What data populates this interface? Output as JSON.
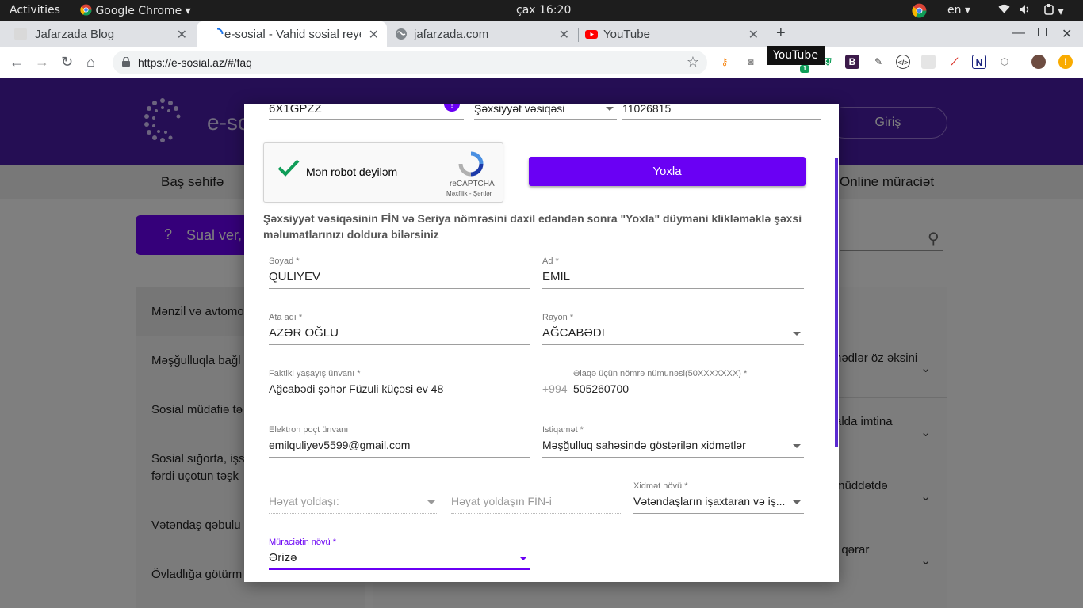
{
  "topbar": {
    "activities": "Activities",
    "app_name": "Google Chrome",
    "clock": "çax 16:20",
    "language": "en"
  },
  "tabs": [
    {
      "label": "Jafarzada Blog",
      "icon": "blog-icon"
    },
    {
      "label": "e-sosial - Vahid sosial reye",
      "icon": "loading-icon"
    },
    {
      "label": "jafarzada.com",
      "icon": "globe-icon"
    },
    {
      "label": "YouTube",
      "icon": "youtube-icon"
    }
  ],
  "toolbar": {
    "url": "https://e-sosial.az/#/faq"
  },
  "tooltip": "YouTube",
  "background": {
    "logo_text": "e-so",
    "login_label": "Giriş",
    "nav_home": "Baş səhifə",
    "nav_online": "Online müraciət",
    "ask_button": "Sual ver,",
    "sidebar_items": [
      "Mənzil və avtomo",
      "Məşğulluqla bağl",
      "Sosial müdafiə tə",
      "Sosial sığorta, işs",
      "fərdi uçotun təşk",
      "Vətəndaş qəbulu",
      "Övladlığa götürm"
    ],
    "right_texts": [
      "hədlər öz əksini",
      "alda imtina",
      "müddətdə",
      "t qərar"
    ]
  },
  "modal": {
    "top_row": {
      "fin_value": "6X1GPZZ",
      "doc_type": "Şəxsiyyət vəsiqəsi",
      "doc_number": "11026815"
    },
    "recaptcha": {
      "label": "Mən robot deyiləm",
      "brand": "reCAPTCHA",
      "links": "Məxfilik - Şərtlər"
    },
    "check_button": "Yoxla",
    "info_text": "Şəxsiyyət vəsiqəsinin FİN və Seriya nömrəsini daxil edəndən sonra \"Yoxla\" düyməni klikləməklə şəxsi məlumatlarınızı doldura bilərsiniz",
    "fields": {
      "surname": {
        "label": "Soyad *",
        "value": "QULIYEV"
      },
      "name": {
        "label": "Ad *",
        "value": "EMIL"
      },
      "father": {
        "label": "Ata adı *",
        "value": "AZƏR OĞLU"
      },
      "district": {
        "label": "Rayon *",
        "value": "AĞCABƏDI"
      },
      "address": {
        "label": "Faktiki yaşayış ünvanı *",
        "value": "Ağcabədi şəhər Füzuli küçəsi ev 48"
      },
      "phone": {
        "label": "Əlaqə üçün nömrə nümunəsi(50XXXXXXX) *",
        "prefix": "+994",
        "value": "505260700"
      },
      "email": {
        "label": "Elektron poçt ünvanı",
        "value": "emilquliyev5599@gmail.com"
      },
      "direction": {
        "label": "Istiqamət *",
        "value": "Məşğulluq sahəsində  göstərilən xidmətlər"
      },
      "spouse": {
        "placeholder": "Həyat yoldaşı:"
      },
      "spouse_fin": {
        "placeholder": "Həyat yoldaşın FİN-i"
      },
      "service_type": {
        "label": "Xidmət növü *",
        "value": "Vətəndaşların işaxtaran və iş..."
      },
      "request_type": {
        "label": "Müraciətin növü *",
        "value": "Ərizə"
      }
    }
  },
  "colors": {
    "brand_purple": "#6a00f4",
    "header_purple": "#4a1ca8",
    "check_green": "#0f9d58"
  }
}
